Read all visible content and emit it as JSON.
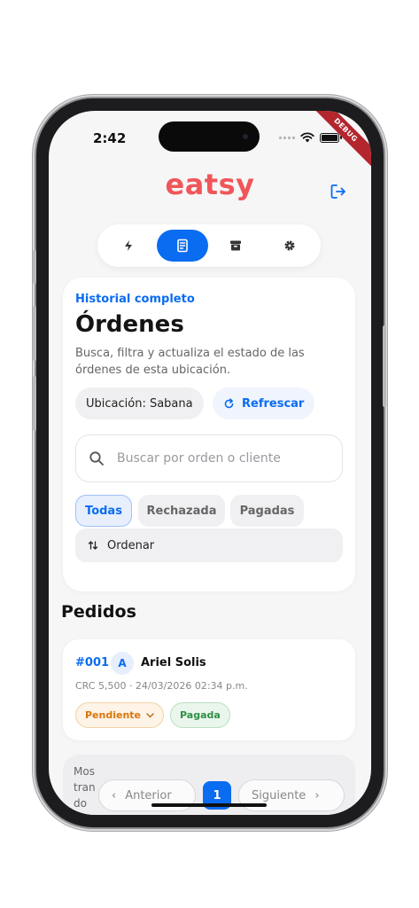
{
  "status": {
    "time": "2:42",
    "debug": "DEBUG"
  },
  "app": {
    "logo": "eatsy",
    "accent": "#0a6cf0",
    "brand": "#f0565a"
  },
  "tabs": [
    {
      "icon": "bolt-icon"
    },
    {
      "icon": "receipt-icon",
      "active": true
    },
    {
      "icon": "archive-icon"
    },
    {
      "icon": "gear-icon"
    }
  ],
  "orders_panel": {
    "eyebrow": "Historial completo",
    "title": "Órdenes",
    "description": "Busca, filtra y actualiza el estado de las órdenes de esta ubicación.",
    "location_chip": "Ubicación: Sabana",
    "refresh_label": "Refrescar",
    "search_placeholder": "Buscar por orden o cliente",
    "filters": [
      "Todas",
      "Rechazada",
      "Pagadas"
    ],
    "sort_label": "Ordenar"
  },
  "section_title": "Pedidos",
  "orders": [
    {
      "id": "#001",
      "avatar": "A",
      "customer": "Ariel Solis",
      "meta": "CRC 5,500 · 24/03/2026 02:34 p.m.",
      "status": "Pendiente",
      "payment": "Pagada"
    }
  ],
  "pagination": {
    "showing_lines": [
      "Mos",
      "tran",
      "do"
    ],
    "prev": "Anterior",
    "page": "1",
    "next": "Siguiente"
  }
}
